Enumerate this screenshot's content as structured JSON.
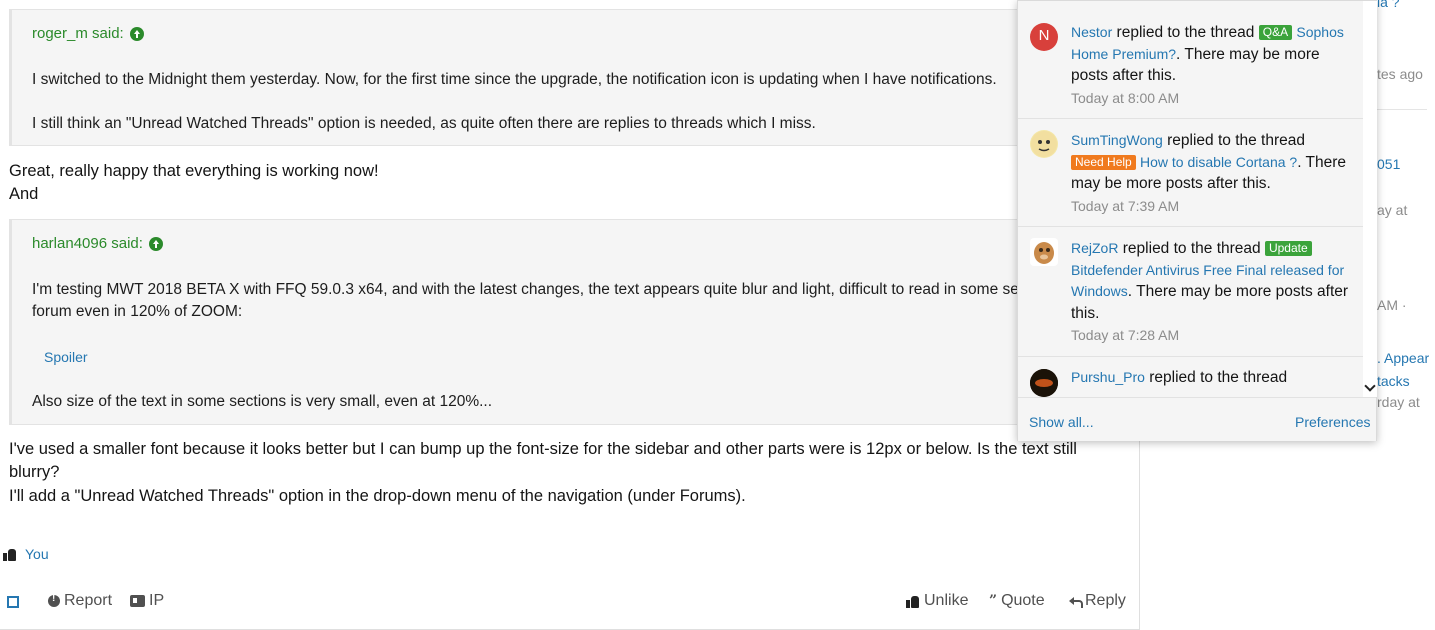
{
  "post": {
    "quote1": {
      "author_said": "roger_m said:",
      "lines": [
        "I switched to the Midnight them yesterday. Now, for the first time since the upgrade, the notification icon is updating when I have notifications.",
        "I still think an \"Unread Watched Threads\" option is needed, as quite often there are replies to threads which I miss."
      ]
    },
    "reply1": [
      "Great, really happy that everything is working now!",
      "And"
    ],
    "quote2": {
      "author_said": "harlan4096 said:",
      "lines": [
        "I'm testing MWT 2018 BETA X with FFQ 59.0.3 x64, and with the latest changes, the text appears quite blur and light, difficult to read in some sec",
        "forum even in 120% of ZOOM:",
        "Also size of the text in some sections is very small, even at 120%..."
      ],
      "spoiler_label": "Spoiler"
    },
    "reply2": [
      "I've used a smaller font because it looks better but I can bump up the font-size for the sidebar and other parts were is 12px or below. Is the text still",
      "blurry?",
      "I'll add a \"Unread Watched Threads\" option in the drop-down menu of the navigation (under Forums)."
    ],
    "likes": {
      "label": "You"
    },
    "actions": {
      "report": "Report",
      "ip": "IP",
      "unlike": "Unlike",
      "quote": "Quote",
      "reply": "Reply"
    }
  },
  "sidebar_fragments": {
    "f1": "la ?",
    "f2": "tes ago",
    "f3": "051",
    "f4": "ay at",
    "f5": "AM ·",
    "f6": ". Appear",
    "f7": "tacks",
    "f8": "rday at"
  },
  "alerts": [
    {
      "user": "Nestor",
      "action": " replied to the thread ",
      "prefix": "Q&A",
      "thread": "Sophos Home Premium?",
      "suffix": ". There may be more posts after this.",
      "time": "Today at 8:00 AM",
      "avatar_letter": "N",
      "avatar_color": "#d8403b"
    },
    {
      "user": "SumTingWong",
      "action": " replied to the thread ",
      "prefix": "Need Help",
      "thread": "How to disable Cortana ?",
      "suffix": ". There may be more posts after this.",
      "time": "Today at 7:39 AM"
    },
    {
      "user": "RejZoR",
      "action": " replied to the thread ",
      "prefix": "Update",
      "thread": "Bitdefender Antivirus Free Final released for Windows",
      "suffix": ". There may be more posts after this.",
      "time": "Today at 7:28 AM"
    },
    {
      "user": "Purshu_Pro",
      "action": " replied to the thread"
    }
  ],
  "popup_footer": {
    "show_all": "Show all...",
    "preferences": "Preferences"
  }
}
